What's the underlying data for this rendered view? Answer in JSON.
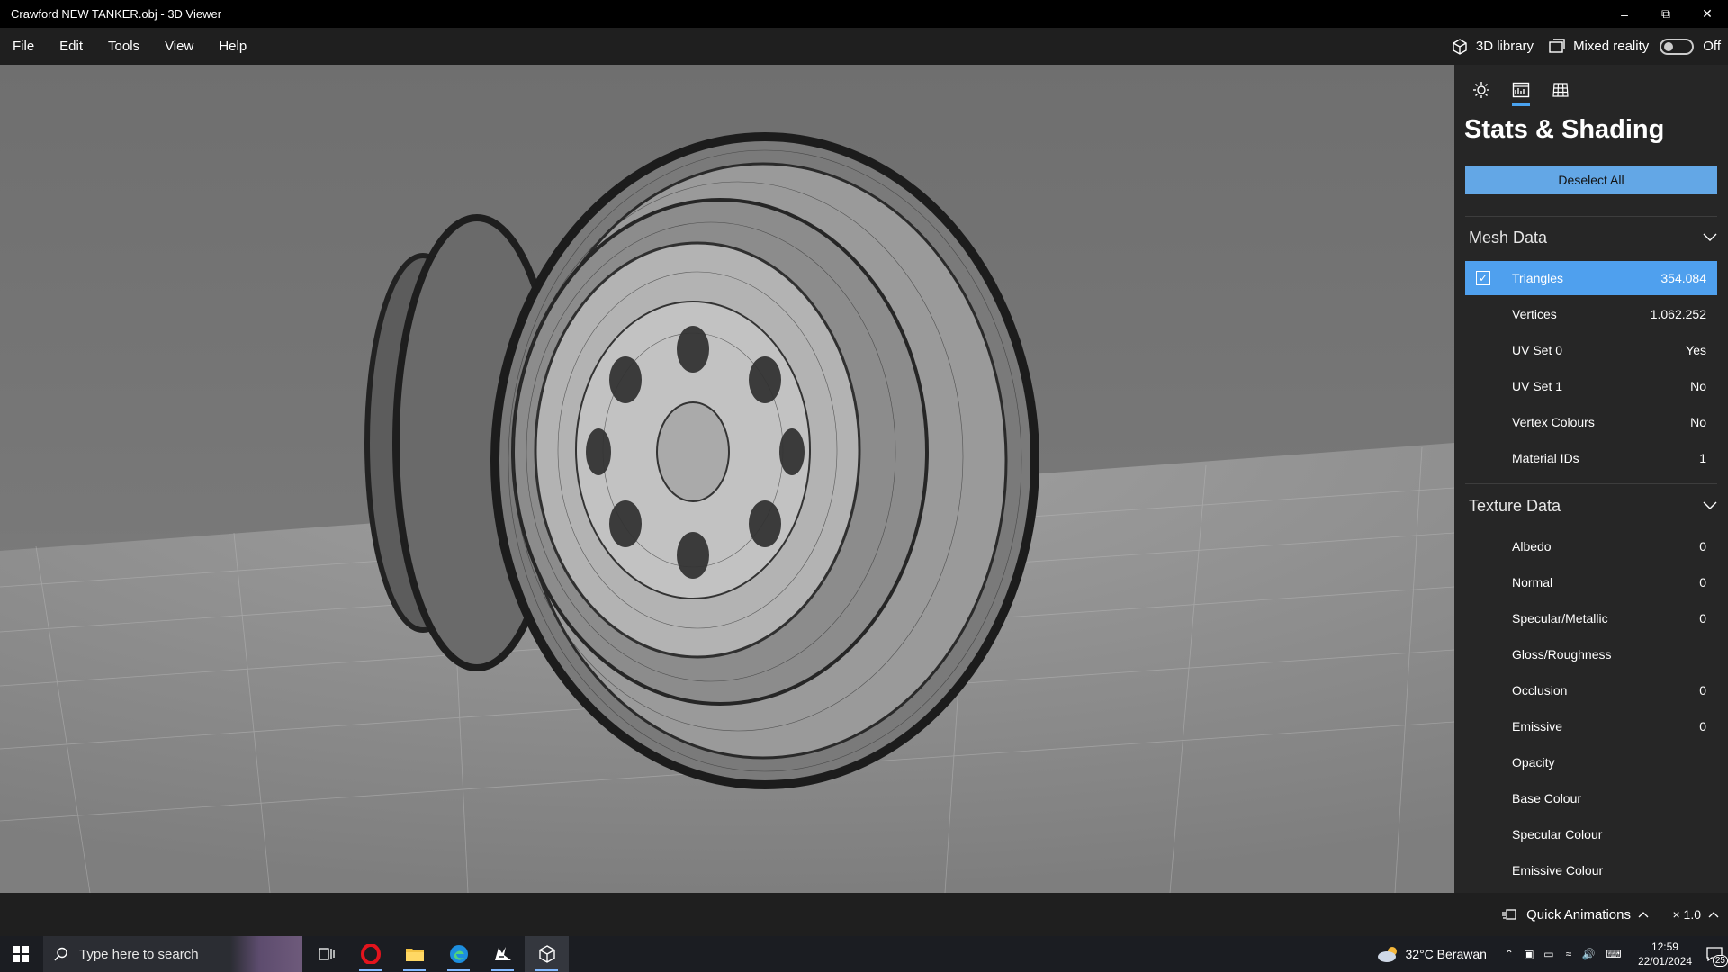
{
  "window": {
    "title": "Crawford NEW TANKER.obj - 3D Viewer"
  },
  "menu": [
    "File",
    "Edit",
    "Tools",
    "View",
    "Help"
  ],
  "menu_right": {
    "library": "3D library",
    "mixed_reality": "Mixed reality",
    "mixed_reality_state": "Off"
  },
  "panel": {
    "tab_icons": [
      "sun-icon",
      "stats-icon",
      "grid-icon"
    ],
    "active_tab": 1,
    "title": "Stats & Shading",
    "deselect_label": "Deselect All",
    "mesh_header": "Mesh Data",
    "mesh_rows": [
      {
        "label": "Triangles",
        "value": "354.084",
        "selected": true
      },
      {
        "label": "Vertices",
        "value": "1.062.252"
      },
      {
        "label": "UV Set 0",
        "value": "Yes"
      },
      {
        "label": "UV Set 1",
        "value": "No"
      },
      {
        "label": "Vertex Colours",
        "value": "No"
      },
      {
        "label": "Material IDs",
        "value": "1"
      }
    ],
    "texture_header": "Texture Data",
    "texture_rows": [
      {
        "label": "Albedo",
        "value": "0"
      },
      {
        "label": "Normal",
        "value": "0"
      },
      {
        "label": "Specular/Metallic",
        "value": "0"
      },
      {
        "label": "Gloss/Roughness",
        "value": ""
      },
      {
        "label": "Occlusion",
        "value": "0"
      },
      {
        "label": "Emissive",
        "value": "0"
      },
      {
        "label": "Opacity",
        "value": ""
      },
      {
        "label": "Base Colour",
        "value": ""
      },
      {
        "label": "Specular Colour",
        "value": ""
      },
      {
        "label": "Emissive Colour",
        "value": ""
      }
    ]
  },
  "status": {
    "quick_animations": "Quick Animations",
    "speed": "× 1.0"
  },
  "taskbar": {
    "search_placeholder": "Type here to search",
    "weather": "32°C  Berawan",
    "time": "12:59",
    "date": "22/01/2024",
    "notifications": "25"
  },
  "colors": {
    "accent": "#4fa0ee",
    "button": "#63a7e6",
    "panel": "#262626"
  }
}
